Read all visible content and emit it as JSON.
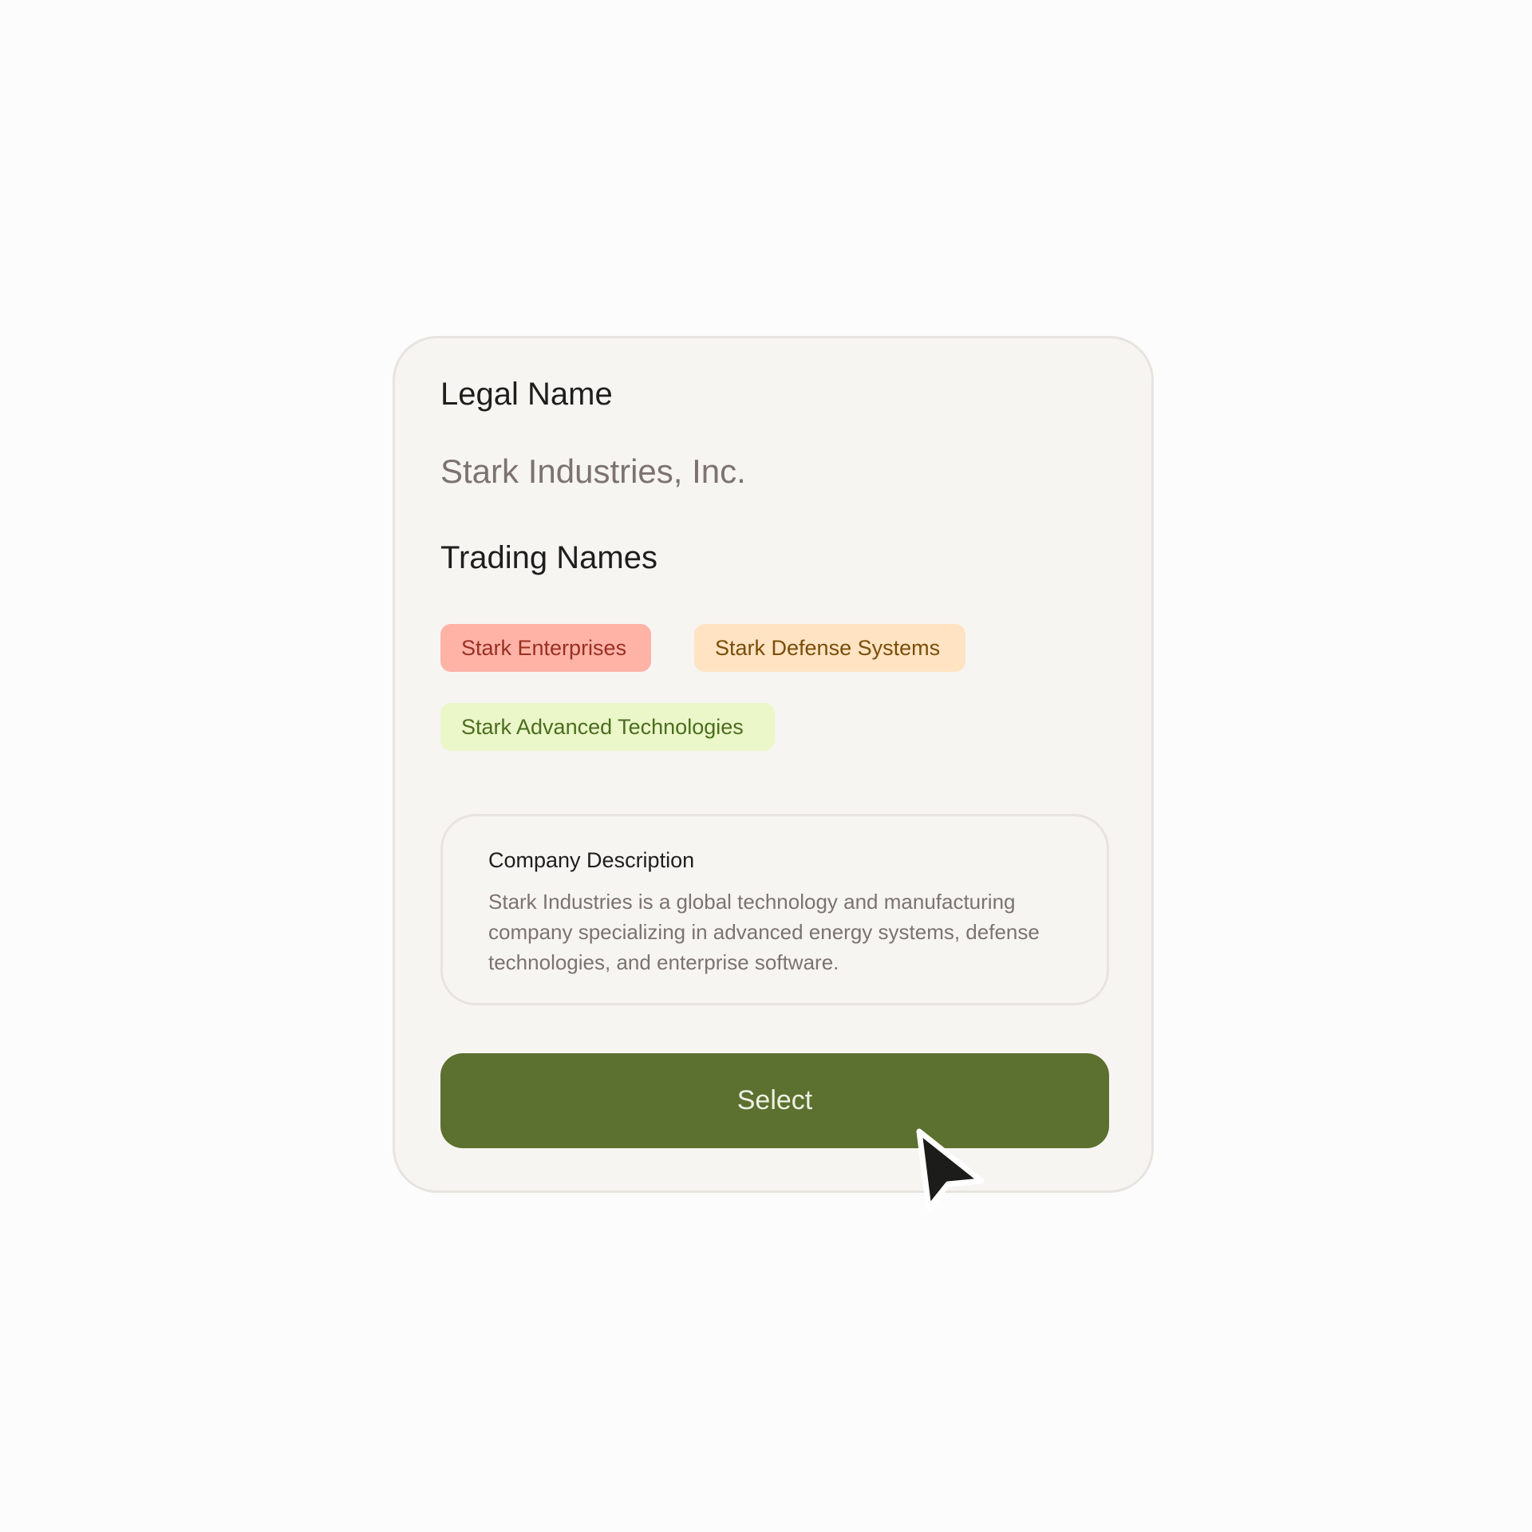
{
  "legal_name": {
    "label": "Legal Name",
    "value": "Stark Industries, Inc."
  },
  "trading_names": {
    "label": "Trading Names",
    "tags": [
      {
        "label": "Stark Enterprises",
        "color": "#ffb3a7",
        "text_color": "#9a2f22"
      },
      {
        "label": "Stark Defense Systems",
        "color": "#ffe3c3",
        "text_color": "#7a4d07"
      },
      {
        "label": "Stark Advanced Technologies",
        "color": "#ebf7c9",
        "text_color": "#4b6d1e"
      }
    ]
  },
  "description": {
    "title": "Company Description",
    "text": "Stark Industries is a global technology and manufacturing company specializing in advanced energy systems, defense technologies, and enterprise software."
  },
  "actions": {
    "select_label": "Select",
    "select_color": "#5c702f"
  },
  "cursor": {
    "icon": "mouse-pointer-icon"
  }
}
